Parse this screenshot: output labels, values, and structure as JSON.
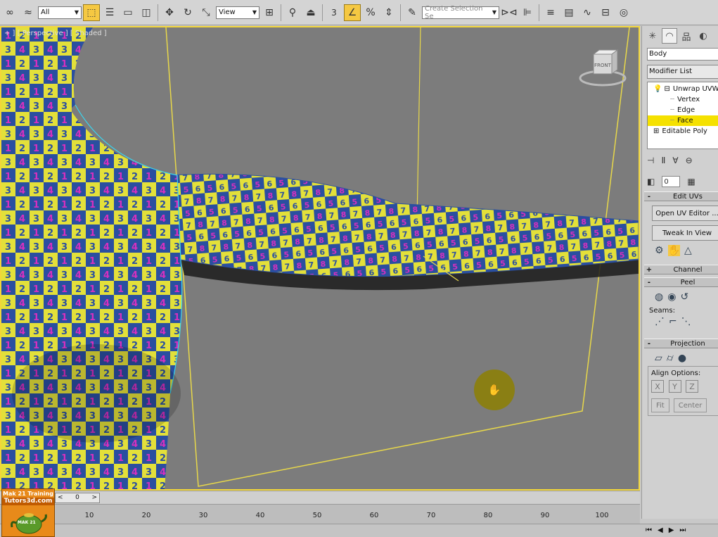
{
  "toolbar": {
    "filter_value": "All",
    "coord_value": "View",
    "snap_label": "3",
    "named_selection_placeholder": "Create Selection Se"
  },
  "viewport": {
    "label": "+ ] [ Perspective ] [ Shaded ]",
    "viewcube_label": "FRONT"
  },
  "command_panel": {
    "object_name": "Body",
    "modifier_list_label": "Modifier List",
    "stack": [
      {
        "label": "Unwrap UVW",
        "kind": "modifier",
        "selected": false
      },
      {
        "label": "Vertex",
        "kind": "sub",
        "selected": false
      },
      {
        "label": "Edge",
        "kind": "sub",
        "selected": false
      },
      {
        "label": "Face",
        "kind": "sub",
        "selected": true
      },
      {
        "label": "Editable Poly",
        "kind": "base",
        "selected": false
      }
    ],
    "spinner_value": "0",
    "rollouts": {
      "edit_uvs": {
        "sign": "-",
        "title": "Edit UVs",
        "open_uv_editor": "Open UV Editor ...",
        "tweak_in_view": "Tweak In View"
      },
      "channel": {
        "sign": "+",
        "title": "Channel"
      },
      "peel": {
        "sign": "-",
        "title": "Peel",
        "seams_label": "Seams:"
      },
      "projection": {
        "sign": "-",
        "title": "Projection",
        "align_options_label": "Align Options:",
        "align_x": "X",
        "align_y": "Y",
        "align_z": "Z",
        "fit_label": "Fit",
        "center_label": "Center"
      }
    }
  },
  "timeline": {
    "slider_value": "0",
    "slider_nav_left": "<",
    "slider_nav_right": ">"
  },
  "ruler": {
    "ticks": [
      "10",
      "20",
      "30",
      "40",
      "50",
      "60",
      "70",
      "80",
      "90",
      "100"
    ]
  },
  "logo": {
    "line1": "Mak 21 Training",
    "line2": "Tutors3d.com",
    "line3": "MAK 21"
  },
  "colors": {
    "viewport_border": "#f2d63a",
    "checker_yellow": "#e3e03a",
    "checker_blue": "#2a4fa0",
    "checker_digit": "#d72fbf",
    "selection_highlight": "#f5e100"
  }
}
